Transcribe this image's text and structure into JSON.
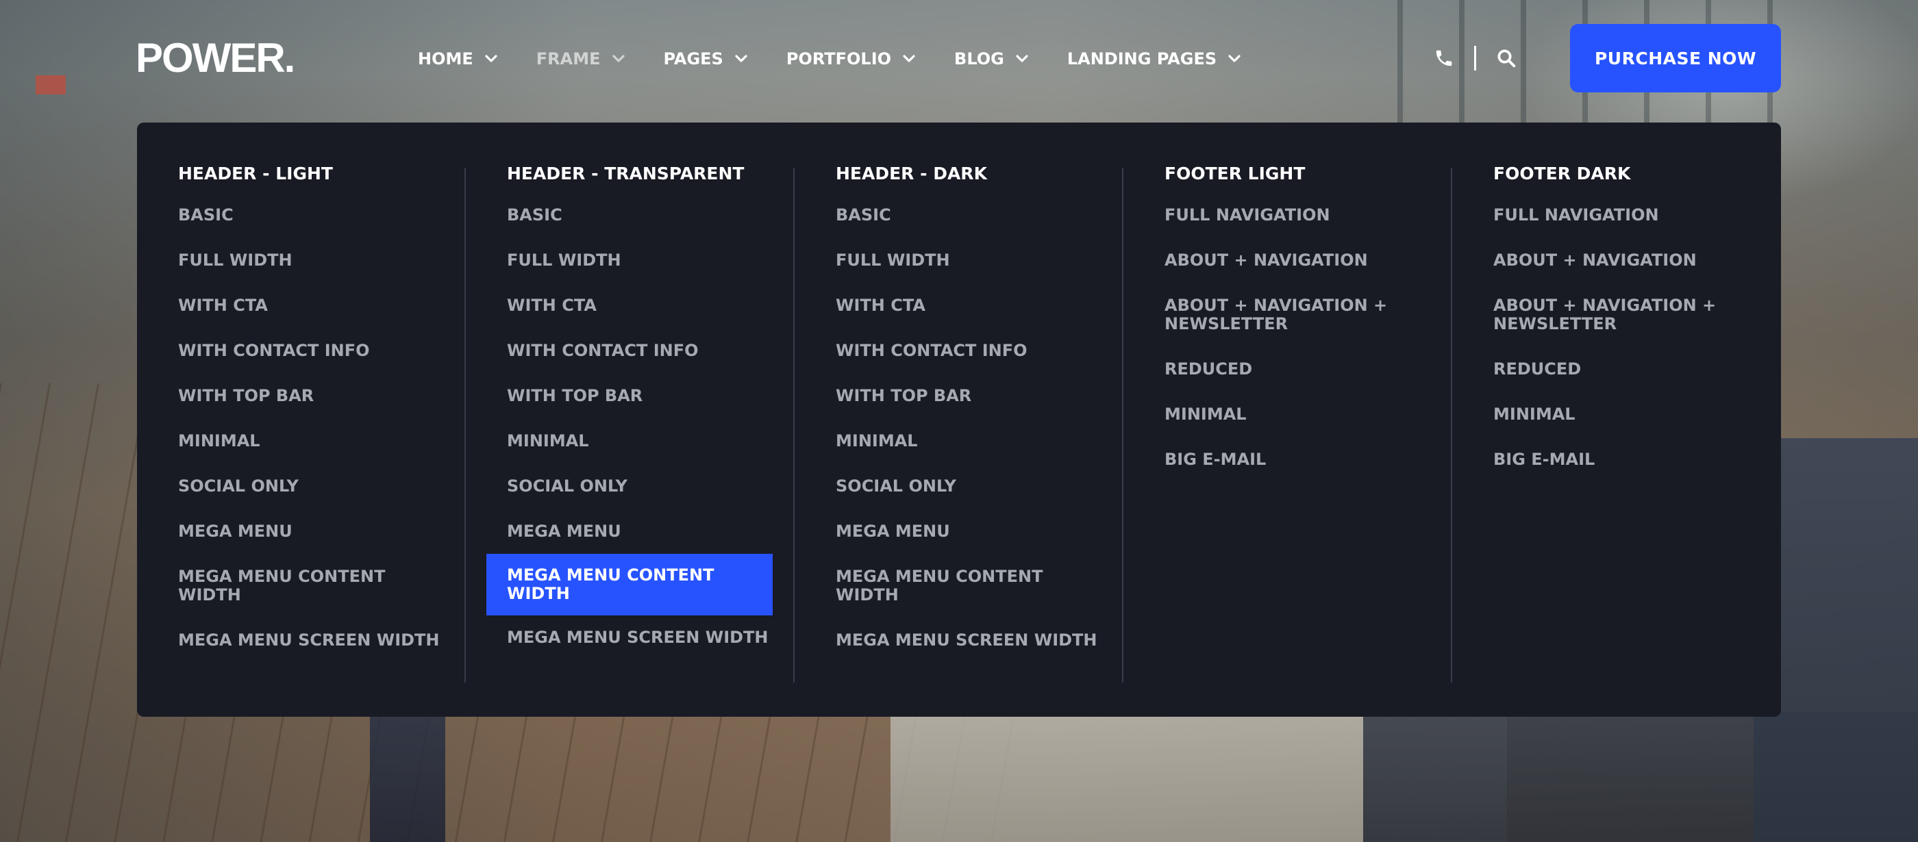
{
  "header": {
    "logo": "POWER.",
    "nav": [
      {
        "label": "HOME",
        "active": false
      },
      {
        "label": "FRAME",
        "active": true
      },
      {
        "label": "PAGES",
        "active": false
      },
      {
        "label": "PORTFOLIO",
        "active": false
      },
      {
        "label": "BLOG",
        "active": false
      },
      {
        "label": "LANDING PAGES",
        "active": false
      }
    ],
    "tools": {
      "phone_icon": "phone-icon",
      "search_icon": "search-icon"
    },
    "purchase_label": "PURCHASE NOW"
  },
  "mega_menu": {
    "columns": [
      {
        "title": "HEADER - LIGHT",
        "items": [
          "BASIC",
          "FULL WIDTH",
          "WITH CTA",
          "WITH CONTACT INFO",
          "WITH TOP BAR",
          "MINIMAL",
          "SOCIAL ONLY",
          "MEGA MENU",
          "MEGA MENU CONTENT WIDTH",
          "MEGA MENU SCREEN WIDTH"
        ]
      },
      {
        "title": "HEADER - TRANSPARENT",
        "items": [
          "BASIC",
          "FULL WIDTH",
          "WITH CTA",
          "WITH CONTACT INFO",
          "WITH TOP BAR",
          "MINIMAL",
          "SOCIAL ONLY",
          "MEGA MENU",
          "MEGA MENU CONTENT WIDTH",
          "MEGA MENU SCREEN WIDTH"
        ],
        "active_item": "MEGA MENU CONTENT WIDTH"
      },
      {
        "title": "HEADER - DARK",
        "items": [
          "BASIC",
          "FULL WIDTH",
          "WITH CTA",
          "WITH CONTACT INFO",
          "WITH TOP BAR",
          "MINIMAL",
          "SOCIAL ONLY",
          "MEGA MENU",
          "MEGA MENU CONTENT WIDTH",
          "MEGA MENU SCREEN WIDTH"
        ]
      },
      {
        "title": "FOOTER LIGHT",
        "items": [
          "FULL NAVIGATION",
          "ABOUT + NAVIGATION",
          "ABOUT + NAVIGATION + NEWSLETTER",
          "REDUCED",
          "MINIMAL",
          "BIG E-MAIL"
        ]
      },
      {
        "title": "FOOTER DARK",
        "items": [
          "FULL NAVIGATION",
          "ABOUT + NAVIGATION",
          "ABOUT + NAVIGATION + NEWSLETTER",
          "REDUCED",
          "MINIMAL",
          "BIG E-MAIL"
        ]
      }
    ]
  },
  "colors": {
    "accent": "#2753ff",
    "panel": "#181a24",
    "menu_text": "#a7a9b1"
  }
}
